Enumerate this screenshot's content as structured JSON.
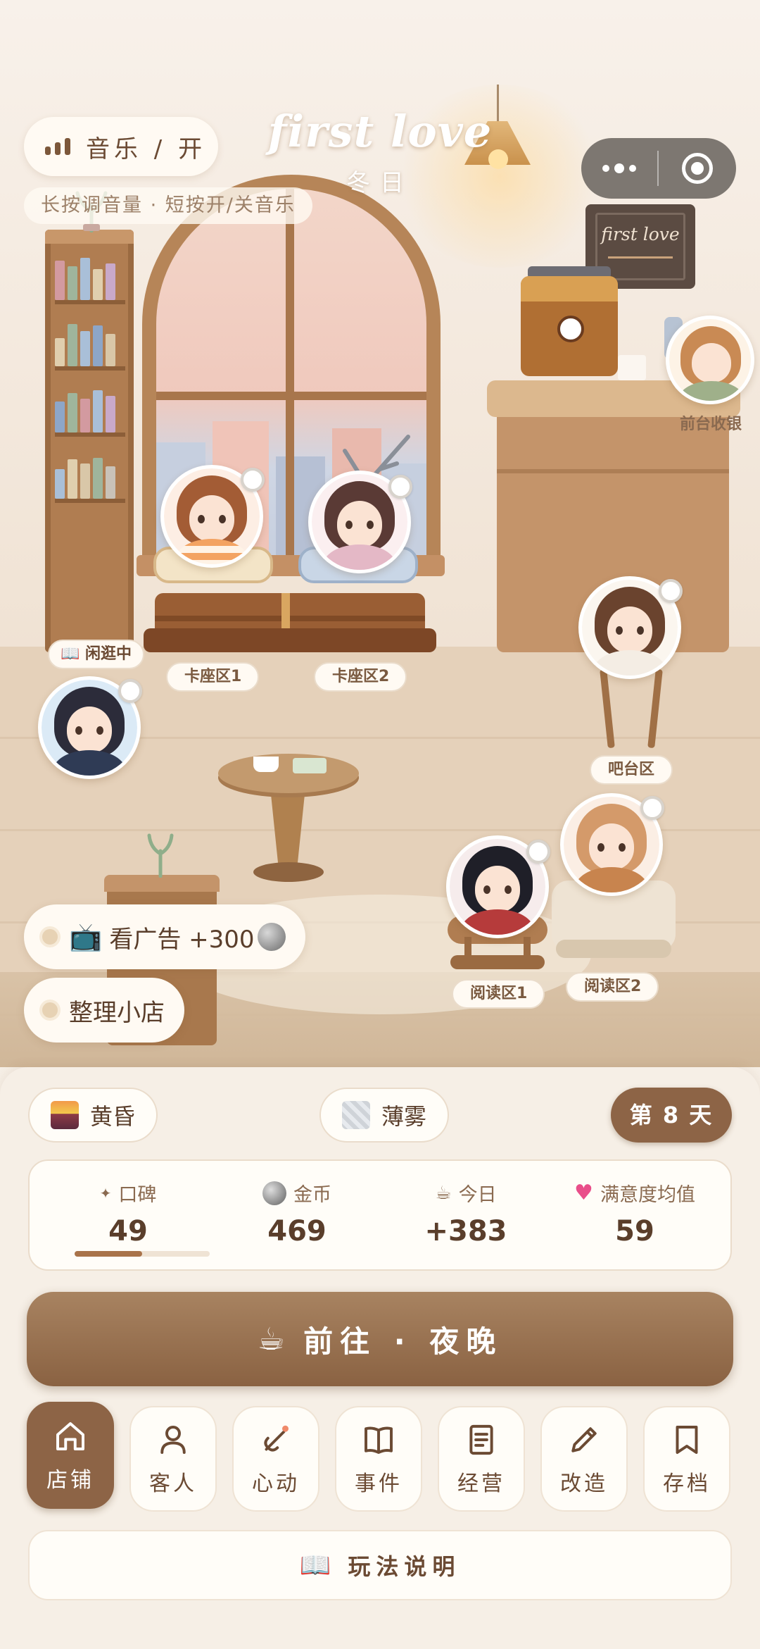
{
  "header": {
    "title": "first love",
    "subtitle": "冬日",
    "music_label": "音乐 / 开",
    "music_hint": "长按调音量 · 短按开/关音乐"
  },
  "scene": {
    "sign_text": "first love",
    "cashier_label": "前台收银",
    "status_tag": "📖 闲逛中",
    "zones": {
      "booth1": "卡座区1",
      "booth2": "卡座区2",
      "bar": "吧台区",
      "reading1": "阅读区1",
      "reading2": "阅读区2"
    },
    "actions": {
      "watch_ad": "看广告 +300",
      "tidy_shop": "整理小店"
    }
  },
  "status_bar": {
    "time_of_day": "黄昏",
    "weather": "薄雾",
    "day": "第 8 天"
  },
  "stats": {
    "reputation": {
      "label": "口碑",
      "value": "49",
      "progress": 0.5
    },
    "coins": {
      "label": "金币",
      "value": "469"
    },
    "today": {
      "label": "今日",
      "value": "+383"
    },
    "satisfaction": {
      "label": "满意度均值",
      "value": "59"
    }
  },
  "goto_button": {
    "icon": "☕",
    "label": "前往 · 夜晚"
  },
  "nav": {
    "items": [
      {
        "label": "店铺",
        "icon": "home-icon",
        "active": true
      },
      {
        "label": "客人",
        "icon": "user-icon"
      },
      {
        "label": "心动",
        "icon": "heart-link-icon"
      },
      {
        "label": "事件",
        "icon": "book-icon"
      },
      {
        "label": "经营",
        "icon": "document-icon"
      },
      {
        "label": "改造",
        "icon": "pencil-icon"
      },
      {
        "label": "存档",
        "icon": "bookmark-icon"
      }
    ]
  },
  "guide": {
    "icon": "📖",
    "label": "玩法说明"
  },
  "colors": {
    "accent": "#8d6446",
    "background": "#f6efe6",
    "text": "#5a3e2b"
  }
}
